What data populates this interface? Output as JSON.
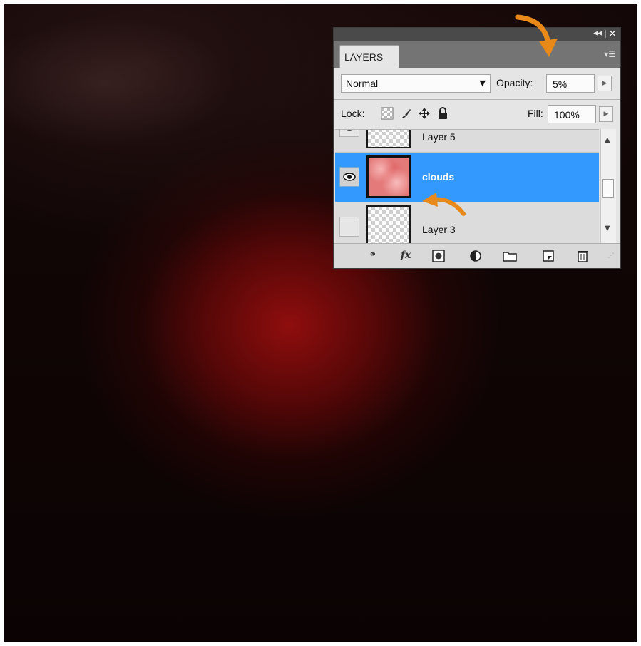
{
  "panel": {
    "tab_label": "LAYERS",
    "blend_mode": "Normal",
    "opacity_label": "Opacity:",
    "opacity_value": "5%",
    "lock_label": "Lock:",
    "fill_label": "Fill:",
    "fill_value": "100%",
    "layers": [
      {
        "name": "Layer 5",
        "visible": true,
        "selected": false
      },
      {
        "name": "clouds",
        "visible": true,
        "selected": true
      },
      {
        "name": "Layer 3",
        "visible": false,
        "selected": false
      }
    ]
  },
  "colors": {
    "selection": "#3399ff",
    "annotation_arrow": "#e8891a",
    "canvas_glow": "#8c0e0e"
  },
  "icons": {
    "top_bar": [
      "collapse-icon",
      "close-icon",
      "panel-menu-icon"
    ],
    "lock": [
      "lock-transparent-icon",
      "lock-paint-icon",
      "lock-move-icon",
      "lock-all-icon"
    ],
    "bottom": [
      "link-layers-icon",
      "fx-icon",
      "mask-icon",
      "adjustment-icon",
      "group-folder-icon",
      "new-layer-icon",
      "trash-icon"
    ]
  }
}
